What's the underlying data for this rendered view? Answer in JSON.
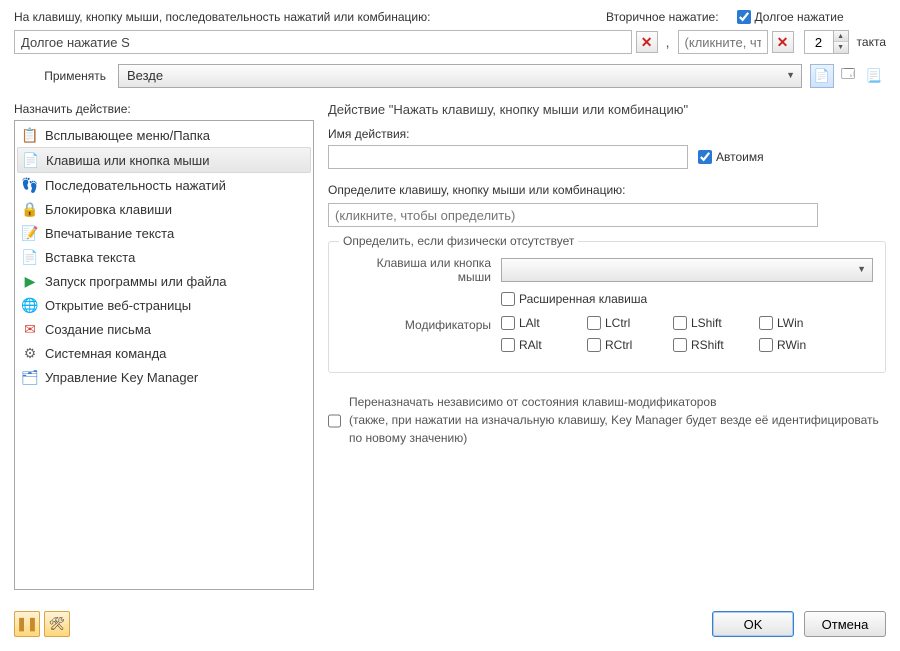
{
  "top": {
    "key_label": "На клавишу, кнопку мыши, последовательность нажатий или комбинацию:",
    "secondary_label": "Вторичное нажатие:",
    "long_press_label": "Долгое нажатие",
    "long_press_checked": true,
    "key_value": "Долгое нажатие S",
    "secondary_placeholder": "(кликните, чт",
    "ticks_value": "2",
    "ticks_label": "такта"
  },
  "apply": {
    "label": "Применять",
    "value": "Везде"
  },
  "actions": {
    "title": "Назначить действие:",
    "items": [
      {
        "label": "Всплывающее меню/Папка",
        "icon": "📋",
        "color": "#3a7bd5"
      },
      {
        "label": "Клавиша или кнопка мыши",
        "icon": "📄",
        "color": "#c78a2a",
        "selected": true
      },
      {
        "label": "Последовательность нажатий",
        "icon": "👣",
        "color": "#3a7bd5"
      },
      {
        "label": "Блокировка клавиши",
        "icon": "🔒",
        "color": "#d14836"
      },
      {
        "label": "Впечатывание текста",
        "icon": "📝",
        "color": "#c78a2a"
      },
      {
        "label": "Вставка текста",
        "icon": "📄",
        "color": "#3a7bd5"
      },
      {
        "label": "Запуск программы или файла",
        "icon": "▶",
        "color": "#2a9d4a"
      },
      {
        "label": "Открытие веб-страницы",
        "icon": "🌐",
        "color": "#2a9d4a"
      },
      {
        "label": "Создание письма",
        "icon": "✉",
        "color": "#d14836"
      },
      {
        "label": "Системная команда",
        "icon": "⚙",
        "color": "#666"
      },
      {
        "label": "Управление Key Manager",
        "icon": "🗂",
        "color": "#3a7bd5"
      }
    ]
  },
  "panel": {
    "title": "Действие \"Нажать клавишу, кнопку мыши или комбинацию\"",
    "name_label": "Имя действия:",
    "name_value": "",
    "autoname_label": "Автоимя",
    "autoname_checked": true,
    "define_label": "Определите клавишу, кнопку мыши или комбинацию:",
    "define_placeholder": "(кликните, чтобы определить)",
    "absent_legend": "Определить, если физически отсутствует",
    "key_or_mouse_label": "Клавиша или кнопка мыши",
    "extended_label": "Расширенная клавиша",
    "modifiers_label": "Модификаторы",
    "modifiers": [
      "LAlt",
      "LCtrl",
      "LShift",
      "LWin",
      "RAlt",
      "RCtrl",
      "RShift",
      "RWin"
    ],
    "reassign_label": "Переназначать независимо от состояния клавиш-модификаторов",
    "reassign_note": "(также, при нажатии на изначальную клавишу, Key Manager будет везде её идентифицировать по новому значению)"
  },
  "footer": {
    "ok": "OK",
    "cancel": "Отмена"
  }
}
